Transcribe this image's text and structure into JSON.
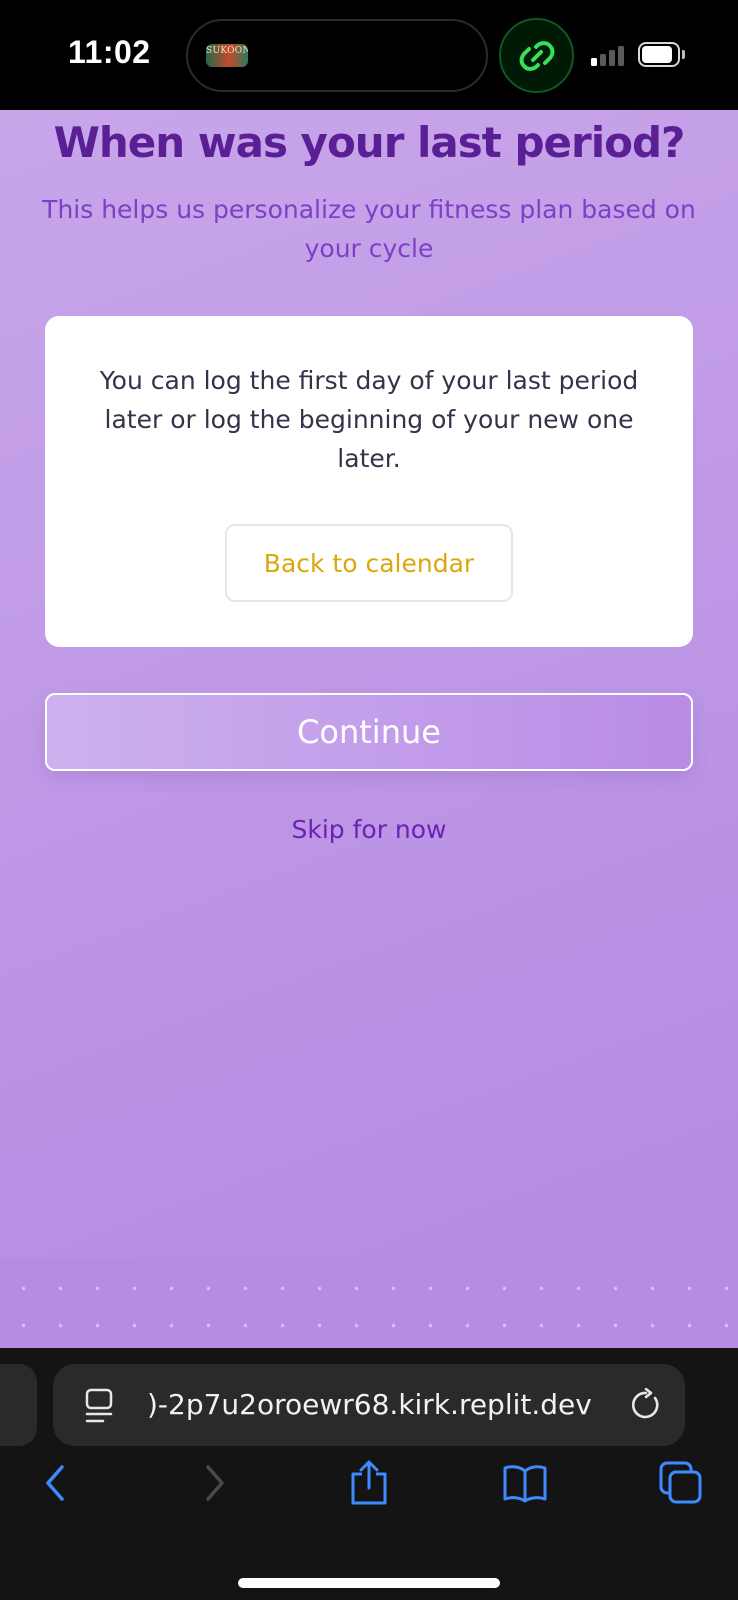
{
  "status_bar": {
    "time": "11:02",
    "island_thumb_text": "SUKOON",
    "link_icon": "link-chain-icon",
    "signal_icon": "cellular-signal-icon",
    "battery_icon": "battery-icon",
    "colors": {
      "link_green": "#35e05c"
    }
  },
  "page": {
    "title": "When was your last period?",
    "subtitle": "This helps us personalize your fitness plan based on your cycle",
    "card": {
      "message": "You can log the first day of your last period later or log the beginning of your new one later.",
      "back_button_label": "Back to calendar"
    },
    "continue_label": "Continue",
    "skip_label": "Skip for now",
    "colors": {
      "title": "#5b1f95",
      "subtitle": "#7c3fc6",
      "back_button_text": "#d9a80c",
      "skip_text": "#6a22b4",
      "background": "#c29ce7"
    }
  },
  "browser": {
    "url": ")-2p7u2oroewr68.kirk.replit.dev",
    "icons": {
      "page_menu": "page-menu-icon",
      "reload": "reload-icon",
      "back": "chevron-left-icon",
      "forward": "chevron-right-icon",
      "share": "share-icon",
      "bookmarks": "book-icon",
      "tabs": "tabs-icon"
    },
    "colors": {
      "accent": "#3d8bff",
      "disabled": "#4a4a4c"
    }
  }
}
